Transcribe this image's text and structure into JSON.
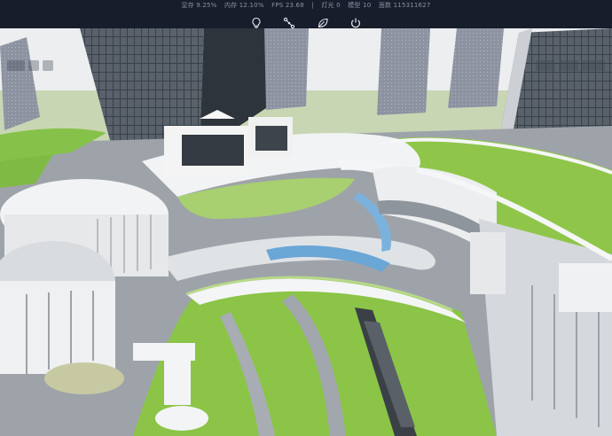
{
  "stats": {
    "gpu": "显存 9.25%",
    "memory": "内存 12.10%",
    "fps": "FPS 23.68",
    "separator": "|",
    "lights": "灯光 0",
    "models": "模型 10",
    "faces": "面数 115311627"
  },
  "toolbar": {
    "icons": [
      "lightbulb-icon",
      "nodes-icon",
      "leaf-icon",
      "power-icon"
    ]
  },
  "colors": {
    "topbar": "#171d2a",
    "lawn": "#8fc64a",
    "path": "#9aa0a8",
    "deck": "#e9ecef"
  }
}
